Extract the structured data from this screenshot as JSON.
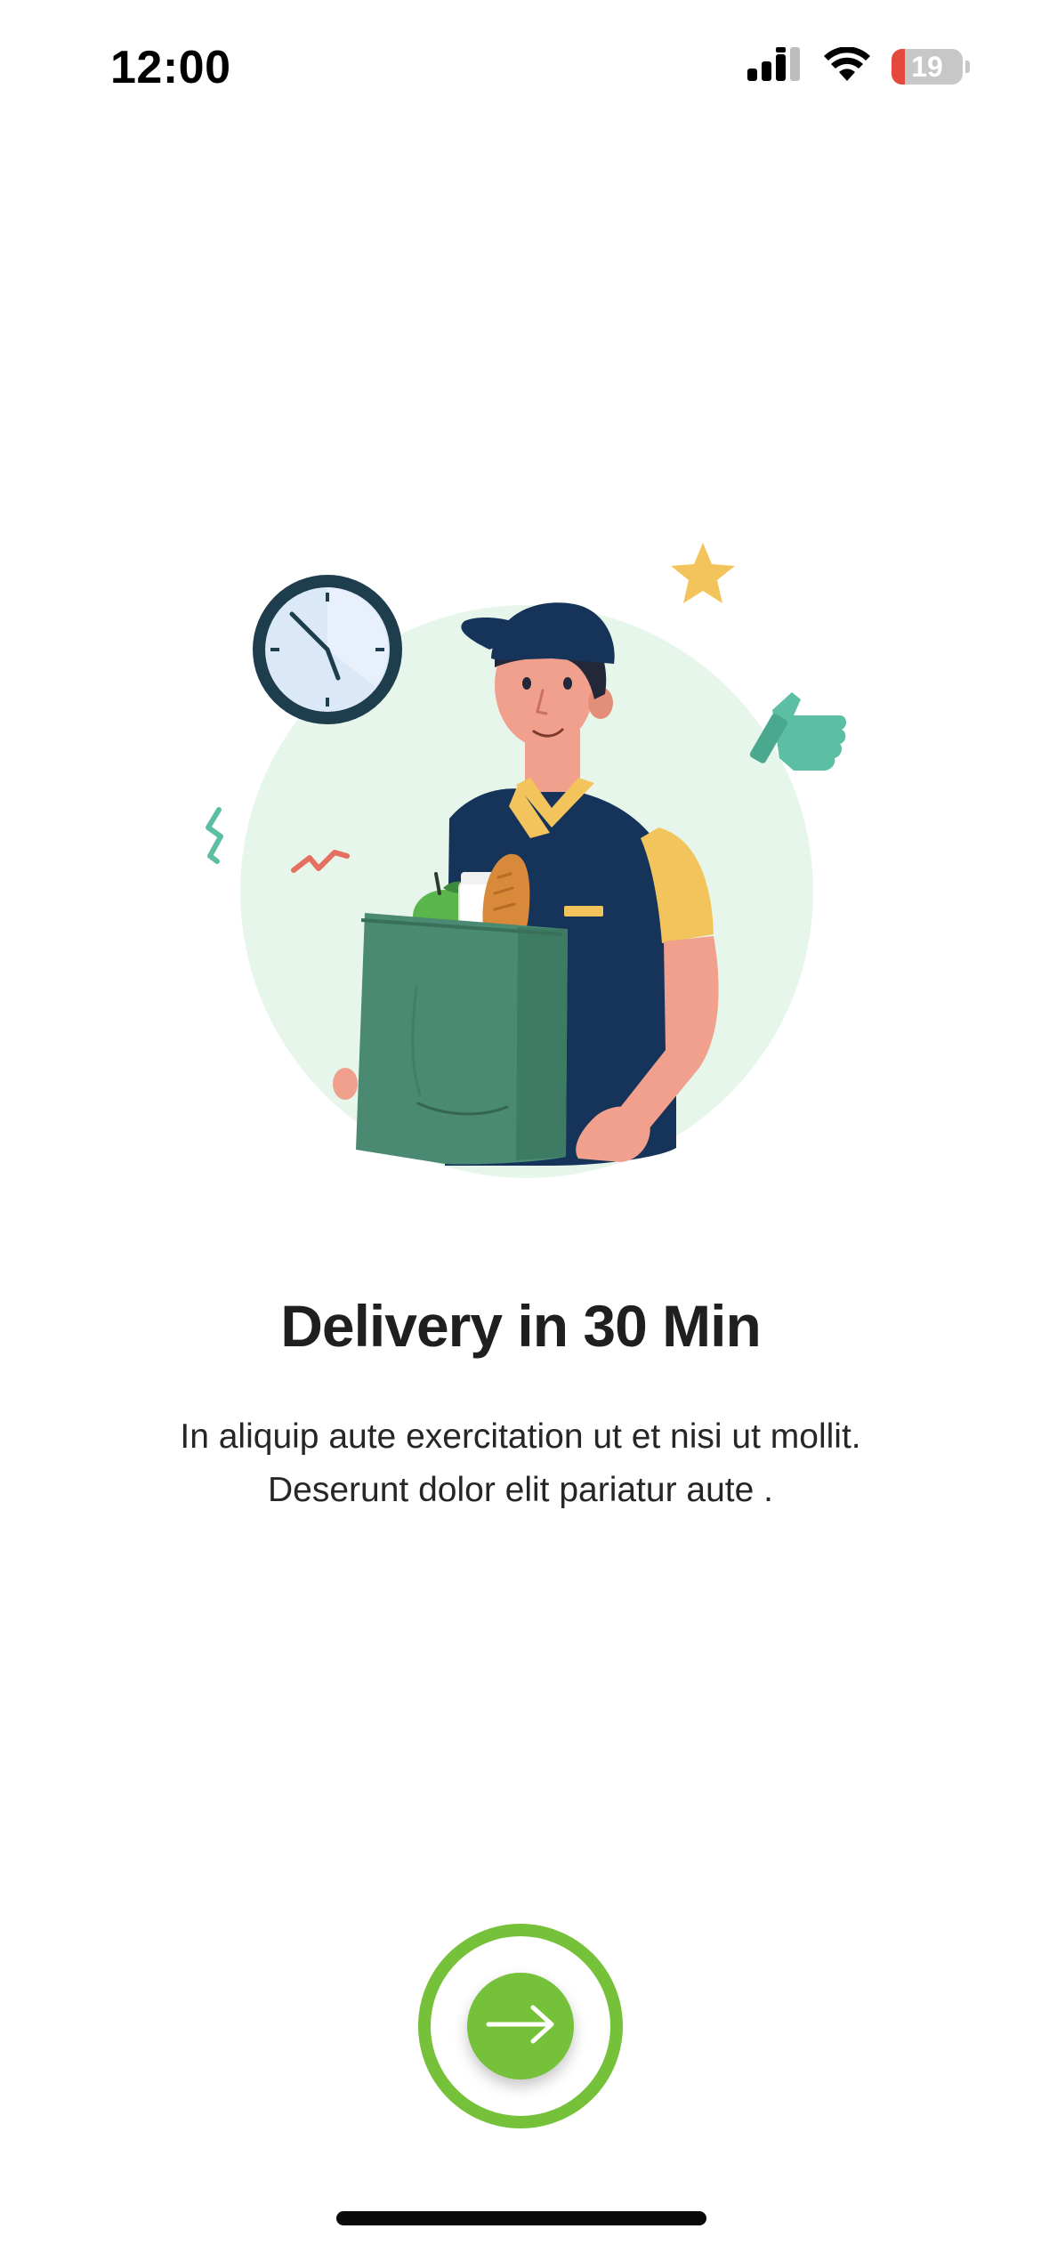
{
  "status_bar": {
    "time": "12:00",
    "battery_level": "19",
    "icons": [
      "cellular-signal-icon",
      "wifi-icon",
      "battery-icon"
    ]
  },
  "illustration": {
    "subject": "delivery-person-with-grocery-bag",
    "elements": [
      "clock-icon",
      "star-icon",
      "thumbs-up-icon"
    ]
  },
  "onboarding": {
    "title": "Delivery in 30 Min",
    "description_line1": "In aliquip aute exercitation ut et nisi ut mollit.",
    "description_line2": "Deserunt dolor elit pariatur aute ."
  },
  "next_button": {
    "icon": "arrow-right-icon"
  },
  "colors": {
    "accent": "#76c13a",
    "title": "#1f1f1f",
    "battery_low": "#e5483d"
  }
}
